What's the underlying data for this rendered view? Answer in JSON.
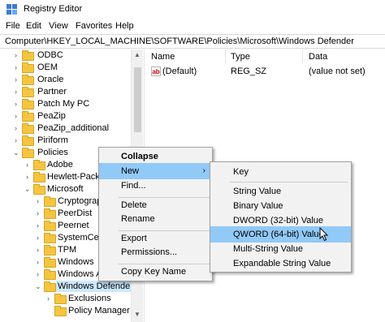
{
  "window": {
    "title": "Registry Editor"
  },
  "menubar": {
    "items": [
      "File",
      "Edit",
      "View",
      "Favorites",
      "Help"
    ]
  },
  "address": {
    "path": "Computer\\HKEY_LOCAL_MACHINE\\SOFTWARE\\Policies\\Microsoft\\Windows Defender"
  },
  "tree": {
    "items": [
      {
        "label": "ODBC"
      },
      {
        "label": "OEM"
      },
      {
        "label": "Oracle"
      },
      {
        "label": "Partner"
      },
      {
        "label": "Patch My PC"
      },
      {
        "label": "PeaZip"
      },
      {
        "label": "PeaZip_additional"
      },
      {
        "label": "Piriform"
      },
      {
        "label": "Policies"
      },
      {
        "label": "Adobe"
      },
      {
        "label": "Hewlett-Packa"
      },
      {
        "label": "Microsoft"
      },
      {
        "label": "Cryptograpl"
      },
      {
        "label": "PeerDist"
      },
      {
        "label": "Peernet"
      },
      {
        "label": "SystemCerti"
      },
      {
        "label": "TPM"
      },
      {
        "label": "Windows"
      },
      {
        "label": "Windows A"
      },
      {
        "label": "Windows Defender"
      },
      {
        "label": "Exclusions"
      },
      {
        "label": "Policy Manager"
      }
    ]
  },
  "list": {
    "headers": {
      "name": "Name",
      "type": "Type",
      "data": "Data"
    },
    "rows": [
      {
        "name": "(Default)",
        "type": "REG_SZ",
        "data": "(value not set)"
      }
    ]
  },
  "context_menu": {
    "collapse": "Collapse",
    "new": "New",
    "find": "Find...",
    "delete": "Delete",
    "rename": "Rename",
    "export": "Export",
    "permissions": "Permissions...",
    "copy_key_name": "Copy Key Name"
  },
  "submenu": {
    "key": "Key",
    "string_value": "String Value",
    "binary_value": "Binary Value",
    "dword_value": "DWORD (32-bit) Value",
    "qword_value": "QWORD (64-bit) Value",
    "multi_string_value": "Multi-String Value",
    "expandable_string_value": "Expandable String Value"
  },
  "colors": {
    "menu_highlight": "#91c9f7",
    "tree_selection": "#cce8ff",
    "folder": "#f5c542"
  }
}
